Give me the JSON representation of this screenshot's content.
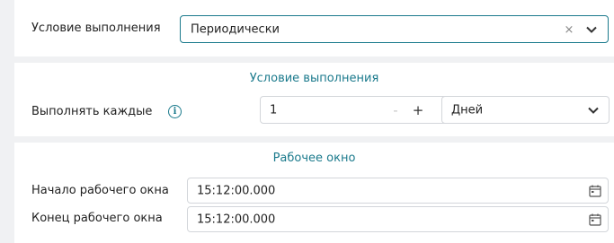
{
  "condition": {
    "label": "Условие выполнения",
    "value": "Периодически",
    "clear_icon": "close-icon",
    "dropdown_icon": "chevron-down-icon"
  },
  "schedule": {
    "section_title": "Условие выполнения",
    "repeat_label": "Выполнять каждые",
    "info_icon": "info-icon",
    "interval_value": "1",
    "decrement_symbol": "-",
    "increment_symbol": "+",
    "unit_value": "Дней"
  },
  "work_window": {
    "section_title": "Рабочее окно",
    "start_label": "Начало рабочего окна",
    "start_value": "15:12:00.000",
    "end_label": "Конец рабочего окна",
    "end_value": "15:12:00.000",
    "calendar_icon": "calendar-icon"
  },
  "colors": {
    "accent": "#1b7a8c",
    "background": "#f0f1f3",
    "border": "#d3d6da"
  }
}
